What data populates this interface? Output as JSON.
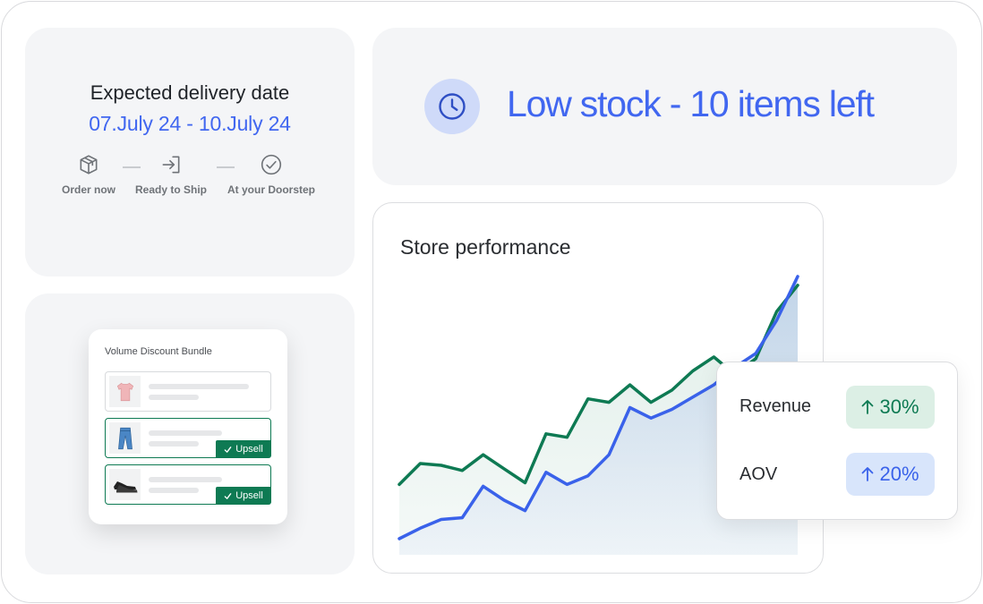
{
  "delivery": {
    "title": "Expected delivery date",
    "dates": "07.July 24 - 10.July 24",
    "steps": [
      {
        "label": "Order now",
        "icon": "package-icon"
      },
      {
        "label": "Ready to Ship",
        "icon": "ship-arrow-icon"
      },
      {
        "label": "At your Doorstep",
        "icon": "check-circle-icon"
      }
    ]
  },
  "stock": {
    "text": "Low stock - 10 items left",
    "icon": "clock-icon",
    "accent": "#4167f0"
  },
  "bundle": {
    "title": "Volume Discount Bundle",
    "items": [
      {
        "product_icon": "tshirt-icon",
        "tag": ""
      },
      {
        "product_icon": "jeans-icon",
        "tag": "Upsell"
      },
      {
        "product_icon": "shoes-icon",
        "tag": "Upsell"
      }
    ],
    "upsell_color": "#0e7a53"
  },
  "performance": {
    "title": "Store performance"
  },
  "stats": {
    "revenue": {
      "label": "Revenue",
      "value": "30%",
      "color": "#0e7a53"
    },
    "aov": {
      "label": "AOV",
      "value": "20%",
      "color": "#3a62ea"
    }
  },
  "chart_data": {
    "type": "area",
    "title": "Store performance",
    "x": [
      0,
      1,
      2,
      3,
      4,
      5,
      6,
      7,
      8,
      9,
      10,
      11,
      12,
      13,
      14,
      15,
      16,
      17,
      18,
      19
    ],
    "series": [
      {
        "color": "#0e7a53",
        "values": [
          31,
          43,
          42,
          39,
          48,
          40,
          32,
          60,
          58,
          80,
          78,
          88,
          78,
          85,
          96,
          104,
          94,
          103,
          130,
          145
        ]
      },
      {
        "color": "#3a62ea",
        "values": [
          0,
          6,
          11,
          12,
          30,
          22,
          16,
          38,
          31,
          36,
          48,
          75,
          69,
          74,
          81,
          88,
          98,
          106,
          125,
          150
        ]
      }
    ],
    "ylim": [
      0,
      150
    ],
    "grid": false,
    "axes_visible": false
  }
}
